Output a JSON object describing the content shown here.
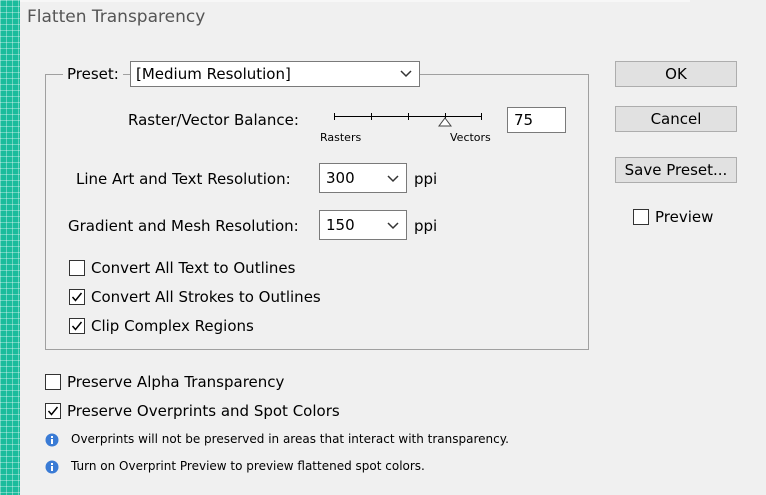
{
  "window": {
    "title": "Flatten Transparency"
  },
  "preset": {
    "label": "Preset:",
    "value": "[Medium Resolution]"
  },
  "balance": {
    "label": "Raster/Vector Balance:",
    "left_label": "Rasters",
    "right_label": "Vectors",
    "value": "75",
    "slider_fraction": 0.75
  },
  "line_art": {
    "label": "Line Art and Text Resolution:",
    "value": "300",
    "unit": "ppi"
  },
  "gradient": {
    "label": "Gradient and Mesh Resolution:",
    "value": "150",
    "unit": "ppi"
  },
  "options": [
    {
      "label": "Convert All Text to Outlines",
      "checked": false
    },
    {
      "label": "Convert All Strokes to Outlines",
      "checked": true
    },
    {
      "label": "Clip Complex Regions",
      "checked": true
    }
  ],
  "preserve": [
    {
      "label": "Preserve Alpha Transparency",
      "checked": false
    },
    {
      "label": "Preserve Overprints and Spot Colors",
      "checked": true
    }
  ],
  "info": [
    "Overprints will not be preserved in areas that interact with transparency.",
    "Turn on Overprint Preview to preview flattened spot colors."
  ],
  "buttons": {
    "ok": "OK",
    "cancel": "Cancel",
    "save_preset": "Save Preset..."
  },
  "preview": {
    "label": "Preview",
    "checked": false
  },
  "colors": {
    "accent_edge": "#1abc9c",
    "dialog_bg": "#f0f0f0",
    "info_icon": "#3a7bd5"
  }
}
